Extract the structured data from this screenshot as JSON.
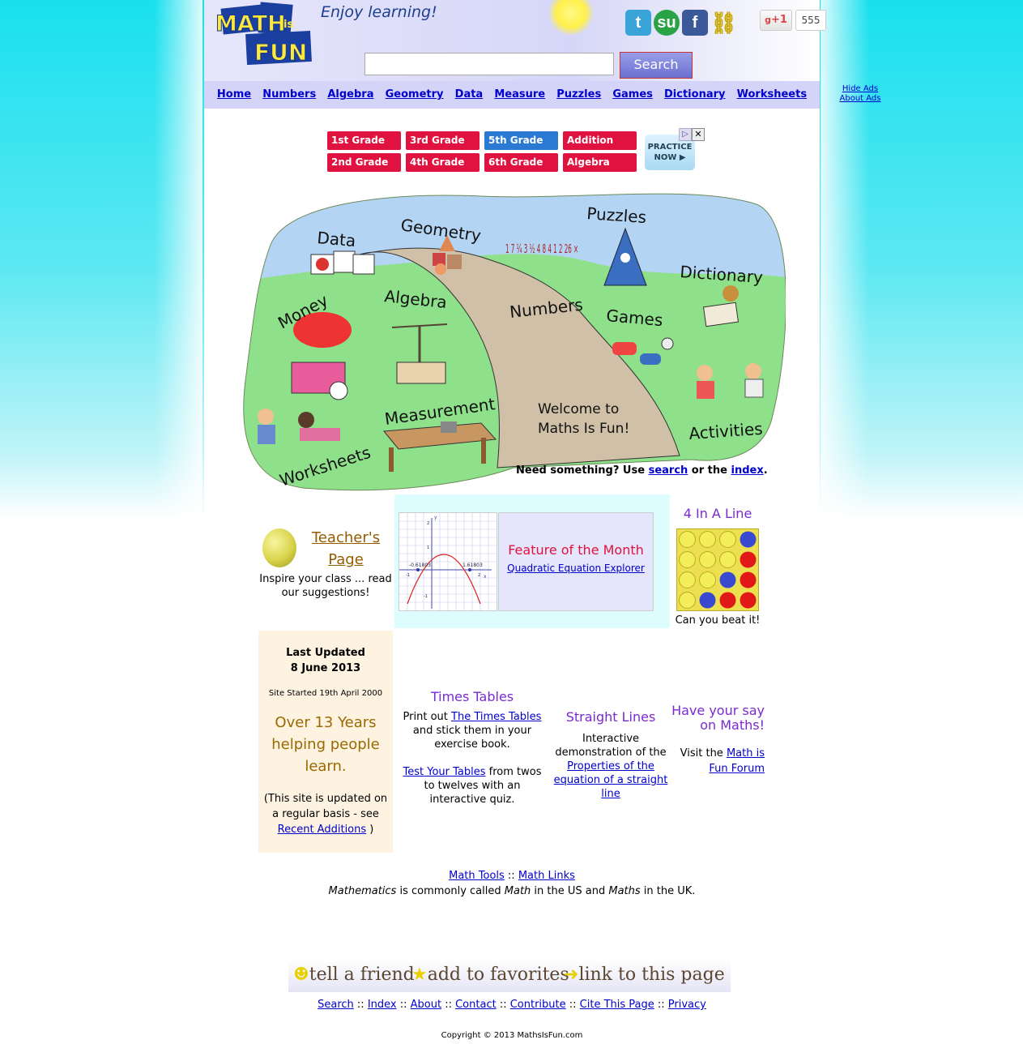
{
  "header": {
    "logo_text": "MATHS IS FUN",
    "tagline": "Enjoy learning!",
    "social": [
      "twitter-icon",
      "stumbleupon-icon",
      "facebook-icon",
      "link-icon"
    ],
    "gplus_label": "+1",
    "gplus_count": "555",
    "search": {
      "value": "",
      "button_label": "Search"
    }
  },
  "nav": {
    "items": [
      "Home",
      "Numbers",
      "Algebra",
      "Geometry",
      "Data",
      "Measure",
      "Puzzles",
      "Games",
      "Dictionary",
      "Worksheets"
    ],
    "hide_ads": "Hide Ads",
    "about_ads": "About Ads"
  },
  "ad": {
    "grades": [
      "1st Grade",
      "3rd Grade",
      "5th Grade",
      "Addition",
      "2nd Grade",
      "4th Grade",
      "6th Grade",
      "Algebra"
    ],
    "practice": "PRACTICE NOW ▶"
  },
  "map": {
    "labels": [
      "Data",
      "Geometry",
      "Puzzles",
      "Dictionary",
      "Money",
      "Algebra",
      "Numbers",
      "Games",
      "Activities",
      "Measurement",
      "Worksheets"
    ],
    "welcome_line1": "Welcome to",
    "welcome_line2": "Maths Is Fun!",
    "numbers_art": "1 7 ¼ 3 ½ 4 8 4 1 2 26 ×",
    "need_prefix": "Need something? Use ",
    "need_search": "search",
    "need_mid": " or the ",
    "need_index": "index",
    "need_suffix": "."
  },
  "teacher": {
    "link": "Teacher's Page",
    "text": "Inspire your class ... read our suggestions!"
  },
  "feature": {
    "title": "Feature of the Month",
    "link": "Quadratic Equation Explorer",
    "graph_labels": [
      "-0.61803",
      "1.61803",
      "x",
      "y",
      "2",
      "1",
      "-1",
      "2",
      "-1"
    ]
  },
  "four_in_line": {
    "title": "4 In A Line",
    "caption": "Can you beat it!"
  },
  "updated": {
    "label": "Last Updated",
    "date": "8 June 2013",
    "started": "Site Started 19th April 2000",
    "years": "Over 13 Years helping people learn.",
    "note_prefix": "(This site is updated on a regular basis - see ",
    "note_link": "Recent Additions",
    "note_suffix": " )"
  },
  "times_tables": {
    "title": "Times Tables",
    "p1_prefix": "Print out ",
    "p1_link": "The Times Tables",
    "p1_suffix": " and stick them in your exercise book.",
    "p2_link": "Test Your Tables",
    "p2_suffix": " from twos to twelves with an interactive quiz."
  },
  "straight_lines": {
    "title": "Straight Lines",
    "text": "Interactive demonstration of the ",
    "link": "Properties of the equation of a straight line"
  },
  "forum": {
    "title": "Have your say on Maths!",
    "prefix": "Visit the ",
    "link": "Math is Fun Forum"
  },
  "bottom": {
    "tools": "Math Tools",
    "sep": " :: ",
    "links": "Math Links",
    "line2_a": "Mathematics",
    "line2_b": " is commonly called ",
    "line2_c": "Math",
    "line2_d": " in the US and ",
    "line2_e": "Maths",
    "line2_f": " in the UK."
  },
  "toolbar": {
    "tell": "tell a friend",
    "fav": "add to favorites",
    "link": "link to this page"
  },
  "footer": {
    "links": [
      "Search",
      "Index",
      "About",
      "Contact",
      "Contribute",
      "Cite This Page",
      "Privacy"
    ],
    "copyright": "Copyright © 2013 MathsIsFun.com"
  },
  "colors": {
    "accent_red": "#e0123f",
    "accent_blue": "#2a7ad4",
    "nav_bg": "#d4d4f8",
    "purple_title": "#7a2ad0"
  }
}
